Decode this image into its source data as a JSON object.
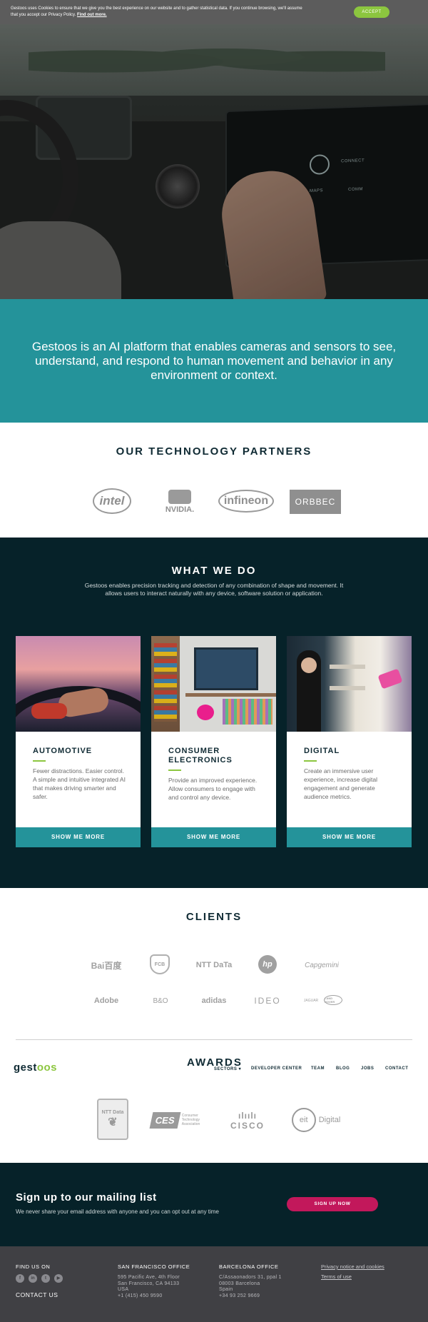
{
  "cookie": {
    "text": "Gestoos uses Cookies to ensure that we give you the best experience on our website and to gather statistical data. If you continue browsing, we'll assume that you accept our Privacy Policy.",
    "link": "Find out more.",
    "accept": "ACCEPT"
  },
  "hero": {
    "screen_labels": [
      "CONNECT",
      "MAPS",
      "COMM"
    ]
  },
  "mission": "Gestoos is an AI platform that enables cameras and sensors to see, understand, and respond to human movement and behavior in any environment or context.",
  "partners": {
    "title": "OUR TECHNOLOGY PARTNERS",
    "logos": [
      "intel",
      "NVIDIA.",
      "infineon",
      "ORBBEC"
    ]
  },
  "what_we_do": {
    "title": "WHAT WE DO",
    "subtitle": "Gestoos enables precision tracking and detection of any combination of shape and movement. It allows users to interact naturally with any device, software solution or application.",
    "cards": [
      {
        "title": "AUTOMOTIVE",
        "text": "Fewer distractions. Easier control. A simple and intuitive integrated AI that makes driving smarter and safer.",
        "button": "SHOW ME MORE"
      },
      {
        "title": "CONSUMER ELECTRONICS",
        "text": "Provide an improved experience. Allow consumers to engage with and control any device.",
        "button": "SHOW ME MORE"
      },
      {
        "title": "DIGITAL",
        "text": "Create an immersive user experience, increase digital engagement and generate audience metrics.",
        "button": "SHOW ME MORE"
      }
    ]
  },
  "clients": {
    "title": "CLIENTS",
    "logos": [
      "Bai百度",
      "FCB",
      "NTT DaTa",
      "hp",
      "Capgemini",
      "Adobe",
      "B&O",
      "adidas",
      "IDEO",
      "JAGUAR",
      "LAND ROVER"
    ]
  },
  "header": {
    "brand_a": "gest",
    "brand_b": "oos",
    "awards": "AWARDS",
    "nav": [
      "SECTORS",
      "DEVELOPER CENTER",
      "TEAM",
      "BLOG",
      "JOBS",
      "CONTACT"
    ]
  },
  "awards_logos": {
    "ntt": "NTT Data",
    "ces_mark": "CES",
    "ces_text": "Consumer Technology Association",
    "cisco": "CISCO",
    "eit_mark": "eit",
    "eit_text": "Digital"
  },
  "mailing": {
    "title": "Sign up to our mailing list",
    "text": "We never share your email address with anyone and you can opt out at any time",
    "button": "SIGN UP NOW"
  },
  "footer": {
    "find_us": "FIND US ON",
    "contact": "CONTACT US",
    "sf_title": "SAN FRANCISCO OFFICE",
    "sf_lines": [
      "595 Pacific Ave, 4th Floor",
      "San Francisco, CA 94133",
      "USA",
      "+1 (415) 450 9590"
    ],
    "bcn_title": "BARCELONA OFFICE",
    "bcn_lines": [
      "C/Assaonadors 31, ppal 1",
      "08003 Barcelona",
      "Spain",
      "+34 93 252 9669"
    ],
    "privacy": "Privacy notice and cookies",
    "terms": "Terms of use"
  },
  "colors": {
    "teal": "#24939a",
    "dark": "#062229",
    "green": "#8cc63f",
    "pink": "#c2185b"
  }
}
